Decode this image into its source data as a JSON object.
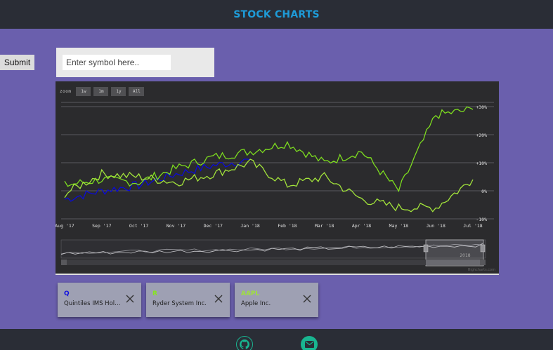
{
  "header": {
    "title": "STOCK CHARTS"
  },
  "search": {
    "placeholder": "Enter symbol here..",
    "value": "",
    "submit_label": "Submit"
  },
  "chart": {
    "zoom_label": "zoom",
    "zoom_buttons": [
      "1w",
      "1m",
      "1y",
      "All"
    ],
    "credit": "Highcharts.com",
    "navigator_labels": [
      "2018"
    ]
  },
  "chart_data": {
    "type": "line",
    "compare": "percent",
    "x": [
      "Aug '17",
      "Sep '17",
      "Oct '17",
      "Nov '17",
      "Dec '17",
      "Jan '18",
      "Feb '18",
      "Mar '18",
      "Apr '18",
      "May '18",
      "Jun '18",
      "Jul '18"
    ],
    "xlabel": "",
    "ylabel": "",
    "y_ticks": [
      "-10%",
      "0%",
      "+10%",
      "+20%",
      "+30%"
    ],
    "ylim": [
      -10,
      30
    ],
    "grid": true,
    "series": [
      {
        "name": "Q",
        "color": "#0b0bd8",
        "values": [
          -3,
          0,
          2,
          6,
          9,
          11
        ]
      },
      {
        "name": "R",
        "color": "#7ddc1f",
        "values": [
          2,
          4,
          3,
          8,
          12,
          14,
          17,
          10,
          14,
          0,
          27,
          29
        ]
      },
      {
        "name": "AAPL",
        "color": "#a2e33b",
        "values": [
          -1,
          6,
          5,
          3,
          6,
          10,
          2,
          5,
          -3,
          -6,
          -6,
          4
        ]
      }
    ]
  },
  "cards": [
    {
      "symbol": "Q",
      "name": "Quintiles IMS Holdings",
      "color": "#1010e0"
    },
    {
      "symbol": "R",
      "name": "Ryder System Inc.",
      "color": "#86e41f"
    },
    {
      "symbol": "AAPL",
      "name": "Apple Inc.",
      "color": "#9fe23a"
    }
  ]
}
